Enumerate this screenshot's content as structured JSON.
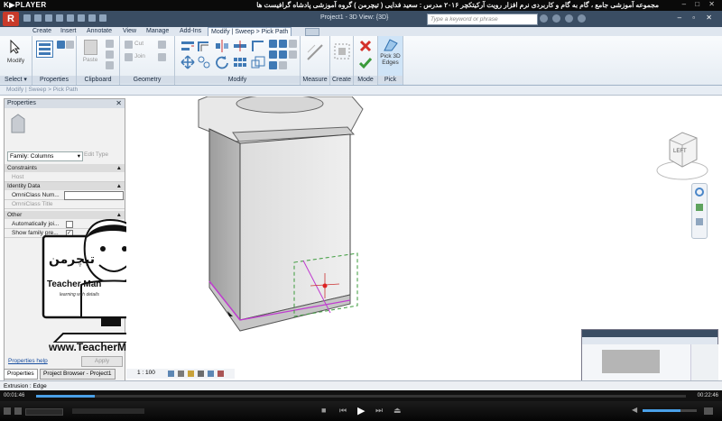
{
  "player": {
    "logo": "K▶PLAYER",
    "title": "مجموعه آموزشی جامع ، گام به گام و کاربردی نرم افزار رویت آرکیتکچر ۲۰۱۶   مدرس : سعید فدایی ( تیچرمن ) گروه آموزشی پادشاه گرافیست ها",
    "window_controls": "– □ ✕",
    "time_elapsed": "00:01:46",
    "time_total": "00:22:46",
    "progress": 0.09
  },
  "qat": {
    "app_button": "R",
    "project_title": "Project1 - 3D View: {3D}",
    "search_placeholder": "Type a keyword or phrase"
  },
  "tabs": [
    {
      "label": "Create"
    },
    {
      "label": "Insert"
    },
    {
      "label": "Annotate"
    },
    {
      "label": "View"
    },
    {
      "label": "Manage"
    },
    {
      "label": "Add-Ins"
    },
    {
      "label": "Modify | Sweep > Pick Path"
    }
  ],
  "ribbon": {
    "select": {
      "modify_label": "Modify",
      "panel_label": "Select ▾"
    },
    "properties": {
      "panel_label": "Properties"
    },
    "clipboard": {
      "paste_label": "Paste",
      "panel_label": "Clipboard"
    },
    "geometry": {
      "cut_label": "Cut",
      "join_label": "Join",
      "panel_label": "Geometry"
    },
    "modify": {
      "panel_label": "Modify"
    },
    "measure": {
      "panel_label": "Measure"
    },
    "create": {
      "panel_label": "Create"
    },
    "mode": {
      "panel_label": "Mode"
    },
    "pick": {
      "button_label": "Pick 3D Edges",
      "panel_label": "Pick"
    }
  },
  "context_bar": "Modify | Sweep > Pick Path",
  "properties_palette": {
    "title": "Properties",
    "family_select": "Family: Columns",
    "edit_type": "Edit Type",
    "rows": [
      {
        "label": "Constraints",
        "section": true
      },
      {
        "label": "Host",
        "value": "",
        "section": false,
        "dim": true
      },
      {
        "label": "Identity Data",
        "section": true
      },
      {
        "label": "OmniClass Num...",
        "value": "",
        "section": false
      },
      {
        "label": "OmniClass Title",
        "value": "",
        "section": false,
        "dim": true
      },
      {
        "label": "Other",
        "section": true
      },
      {
        "label": "Automatically joi...",
        "value": "",
        "section": false
      },
      {
        "label": "Show family pre...",
        "value": "",
        "section": false
      }
    ],
    "help_link": "Properties help",
    "apply_button": "Apply"
  },
  "bottom_tabs": [
    "Properties",
    "Project Browser - Project1"
  ],
  "view_bar": {
    "scale": "1 : 100"
  },
  "status": "Extrusion : Edge",
  "watermark": {
    "brand_fa": "تیچرمن",
    "brand_en": "Teacher Man",
    "tagline": "learning with details",
    "url": "www.TeacherMan.ir"
  },
  "viewcube": {
    "face": "LEFT"
  },
  "colors": {
    "ribbon_blue": "#3f79b5",
    "qat_bg": "#3a4d63",
    "sweep_path": "#c03bd0",
    "pick_green": "#3a9a3a"
  }
}
